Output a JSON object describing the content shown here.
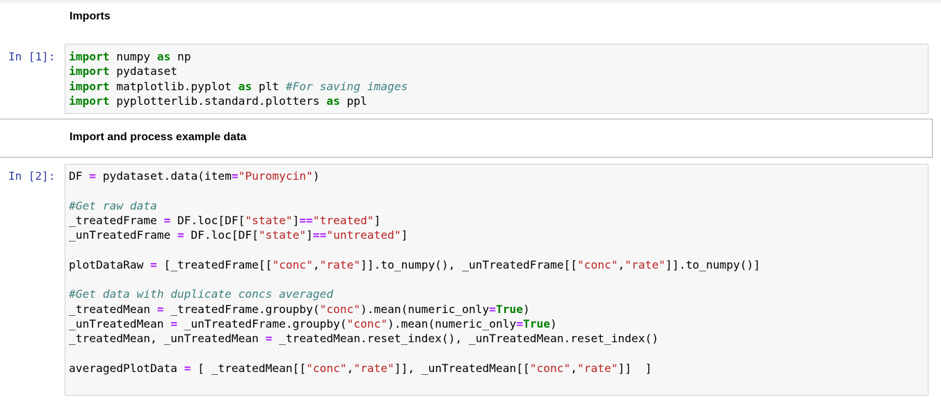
{
  "cells": [
    {
      "type": "markdown",
      "text": "Imports"
    },
    {
      "type": "code",
      "prompt": "In [1]:",
      "lines": [
        [
          {
            "t": "kw",
            "v": "import"
          },
          {
            "t": "pl",
            "v": " numpy "
          },
          {
            "t": "kw",
            "v": "as"
          },
          {
            "t": "pl",
            "v": " np"
          }
        ],
        [
          {
            "t": "kw",
            "v": "import"
          },
          {
            "t": "pl",
            "v": " pydataset"
          }
        ],
        [
          {
            "t": "kw",
            "v": "import"
          },
          {
            "t": "pl",
            "v": " matplotlib.pyplot "
          },
          {
            "t": "kw",
            "v": "as"
          },
          {
            "t": "pl",
            "v": " plt "
          },
          {
            "t": "cm",
            "v": "#For saving images"
          }
        ],
        [
          {
            "t": "kw",
            "v": "import"
          },
          {
            "t": "pl",
            "v": " pyplotterlib.standard.plotters "
          },
          {
            "t": "kw",
            "v": "as"
          },
          {
            "t": "pl",
            "v": " ppl"
          }
        ]
      ]
    },
    {
      "type": "markdown",
      "selected": true,
      "text": "Import and process example data"
    },
    {
      "type": "code",
      "prompt": "In [2]:",
      "lines": [
        [
          {
            "t": "pl",
            "v": "DF "
          },
          {
            "t": "op",
            "v": "="
          },
          {
            "t": "pl",
            "v": " pydataset.data(item"
          },
          {
            "t": "op",
            "v": "="
          },
          {
            "t": "st",
            "v": "\"Puromycin\""
          },
          {
            "t": "pl",
            "v": ")"
          }
        ],
        [],
        [
          {
            "t": "cm",
            "v": "#Get raw data"
          }
        ],
        [
          {
            "t": "pl",
            "v": "_treatedFrame "
          },
          {
            "t": "op",
            "v": "="
          },
          {
            "t": "pl",
            "v": " DF.loc[DF["
          },
          {
            "t": "st",
            "v": "\"state\""
          },
          {
            "t": "pl",
            "v": "]"
          },
          {
            "t": "op",
            "v": "=="
          },
          {
            "t": "st",
            "v": "\"treated\""
          },
          {
            "t": "pl",
            "v": "]"
          }
        ],
        [
          {
            "t": "pl",
            "v": "_unTreatedFrame "
          },
          {
            "t": "op",
            "v": "="
          },
          {
            "t": "pl",
            "v": " DF.loc[DF["
          },
          {
            "t": "st",
            "v": "\"state\""
          },
          {
            "t": "pl",
            "v": "]"
          },
          {
            "t": "op",
            "v": "=="
          },
          {
            "t": "st",
            "v": "\"untreated\""
          },
          {
            "t": "pl",
            "v": "]"
          }
        ],
        [],
        [
          {
            "t": "pl",
            "v": "plotDataRaw "
          },
          {
            "t": "op",
            "v": "="
          },
          {
            "t": "pl",
            "v": " [_treatedFrame[["
          },
          {
            "t": "st",
            "v": "\"conc\""
          },
          {
            "t": "pl",
            "v": ","
          },
          {
            "t": "st",
            "v": "\"rate\""
          },
          {
            "t": "pl",
            "v": "]].to_numpy(), _unTreatedFrame[["
          },
          {
            "t": "st",
            "v": "\"conc\""
          },
          {
            "t": "pl",
            "v": ","
          },
          {
            "t": "st",
            "v": "\"rate\""
          },
          {
            "t": "pl",
            "v": "]].to_numpy()]"
          }
        ],
        [],
        [
          {
            "t": "cm",
            "v": "#Get data with duplicate concs averaged"
          }
        ],
        [
          {
            "t": "pl",
            "v": "_treatedMean "
          },
          {
            "t": "op",
            "v": "="
          },
          {
            "t": "pl",
            "v": " _treatedFrame.groupby("
          },
          {
            "t": "st",
            "v": "\"conc\""
          },
          {
            "t": "pl",
            "v": ").mean(numeric_only"
          },
          {
            "t": "op",
            "v": "="
          },
          {
            "t": "kw",
            "v": "True"
          },
          {
            "t": "pl",
            "v": ")"
          }
        ],
        [
          {
            "t": "pl",
            "v": "_unTreatedMean "
          },
          {
            "t": "op",
            "v": "="
          },
          {
            "t": "pl",
            "v": " _unTreatedFrame.groupby("
          },
          {
            "t": "st",
            "v": "\"conc\""
          },
          {
            "t": "pl",
            "v": ").mean(numeric_only"
          },
          {
            "t": "op",
            "v": "="
          },
          {
            "t": "kw",
            "v": "True"
          },
          {
            "t": "pl",
            "v": ")"
          }
        ],
        [
          {
            "t": "pl",
            "v": "_treatedMean, _unTreatedMean "
          },
          {
            "t": "op",
            "v": "="
          },
          {
            "t": "pl",
            "v": " _treatedMean.reset_index(), _unTreatedMean.reset_index()"
          }
        ],
        [],
        [
          {
            "t": "pl",
            "v": "averagedPlotData "
          },
          {
            "t": "op",
            "v": "="
          },
          {
            "t": "pl",
            "v": " [ _treatedMean[["
          },
          {
            "t": "st",
            "v": "\"conc\""
          },
          {
            "t": "pl",
            "v": ","
          },
          {
            "t": "st",
            "v": "\"rate\""
          },
          {
            "t": "pl",
            "v": "]], _unTreatedMean[["
          },
          {
            "t": "st",
            "v": "\"conc\""
          },
          {
            "t": "pl",
            "v": ","
          },
          {
            "t": "st",
            "v": "\"rate\""
          },
          {
            "t": "pl",
            "v": "]]  ]"
          }
        ]
      ]
    }
  ]
}
